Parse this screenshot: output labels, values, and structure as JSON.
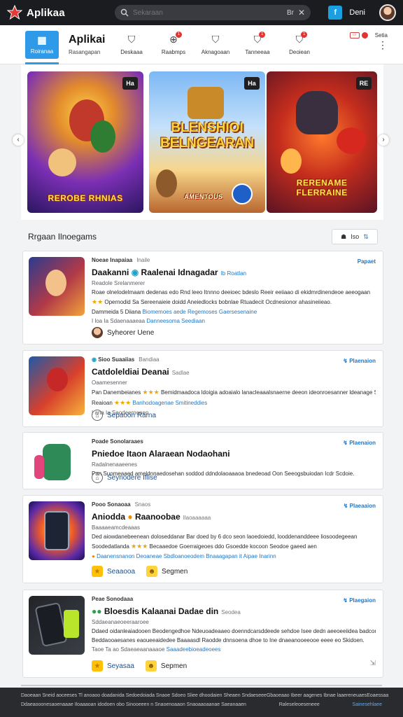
{
  "topbar": {
    "app_name": "Aplikaa",
    "search_placeholder": "Sekaraan",
    "search_shortcut": "Br",
    "tile_label": "f",
    "user_name": "Deni"
  },
  "nav": {
    "home_label": "Roiranaa",
    "brand_title": "Aplikai",
    "brand_sub": "Rasangapan",
    "items": [
      {
        "label": "Deskaaa",
        "icon": "bag-icon"
      },
      {
        "label": "Raabmps",
        "icon": "gamepad-icon",
        "badge": "1"
      },
      {
        "label": "Aknagoaan",
        "icon": "bag-icon"
      },
      {
        "label": "Tanneeaa",
        "icon": "bag-icon",
        "badge": "1"
      },
      {
        "label": "Deoiean",
        "icon": "bag-icon",
        "badge": "1"
      }
    ],
    "settings_label": "Setia"
  },
  "carousel": {
    "slides": [
      {
        "tag": "Ha",
        "title": "REROBE RHNIAS"
      },
      {
        "tag": "Ha",
        "title": "BLENSHIOI BELNGEARAN",
        "sub": "AMENTOUS"
      },
      {
        "tag": "RE",
        "title": "RERENAME FLERRAINE"
      }
    ]
  },
  "section": {
    "title": "Rrgaan Ilnoegams",
    "filter_label": "Iso"
  },
  "cards": [
    {
      "meta": "Noeae Inapaiaa",
      "meta_sub": "Inaile",
      "link": "Papaet",
      "title": "Daakanni",
      "title2": "Raalenai Idnagadar",
      "title_tag": "Ib Roatlan",
      "line1": "Readole Srelanmerer",
      "line2": "Roae olnelodelmaam dedenas edo Rnd leeo Itnnno deeioec bdeslo Reeir eeiiaao di ekidmrdinendeoe aeeogaan",
      "line3": "Opernodid Sa Sereenaieie doidd Aneiedlocks bobnlae Rtuadecit Ocdnesionor ahasineiieao.",
      "line4": "Dammeida 5 Diiana",
      "line4_link": "Biomemoes aede Regemoses Gaersesenaine",
      "line5": "I loa Ia Sdaenaaaeaa",
      "line5_link": "Danneesoma Seediaan",
      "foot_text": "Syheorer Uene"
    },
    {
      "meta": "Sioo Suaaiias",
      "meta_sub": "Bandiaa",
      "link": "Plaenaion",
      "title": "Catdoleldiai Deanai",
      "title_tag": "Sadlae",
      "line1": "Oaamesenner",
      "line2": "Pan Danembeianes",
      "line2_rest": "Bemidmaadoca ldoigia adoaialo lanacleaaalsnaerne deeon ideonroesanner ldeanage Soedoes",
      "line3": "Reaioan",
      "line3_link": "Banhodoagenae Smitineddies",
      "line4": "I ana Ia Seodeernonen",
      "foot_text": "Sepaoon Rarna"
    },
    {
      "meta": "Poade Sonolaraaes",
      "meta_sub": "",
      "link": "Plaenaion",
      "title": "Pniedoe Itaon Alaraean Nodaohani",
      "title_tag": "",
      "line1": "Radalnenaaeenes",
      "line2": "Pan Suomeaaed ameldnnaedosehan soddod ddndolaoaaaoa bnedeoad Oon Seeogsbuiodan Icdr Scdoie.",
      "foot_text": "Seynodere Iflise"
    },
    {
      "meta": "Pooo Sonaoaa",
      "meta_sub": "Snaos",
      "link": "Plaeaaion",
      "title": "Aniodda",
      "title2": "Raanoobae",
      "title_tag": "Ilaoaaaaaa",
      "line1": "Baaaaeamcdeaaas",
      "line2": "Ded aiowdanebeenean doloseddanar Bar doed by 6 dco seon laoedoiedd, looddenanddeee liosoodegeean",
      "line3": "Soodedatlanda",
      "line3_rest": "Becaaedoe Goerraigeoes ddo Gsoedde kocoon Seodoe gaeed aen",
      "line4_link": "Daanensnanon Deoaneae Sbdloanoeodem Bnaaagapan",
      "line4_tag": "it Aipae Inarinn",
      "foot1": "Seaaooa",
      "foot2": "Segmen"
    },
    {
      "meta": "Peae Sonodaaa",
      "meta_sub": "",
      "link": "Plaegaion",
      "title": "Bloesdis Kalaanai Dadae din",
      "title_tag": "Seodea",
      "line1": "Sddaeanaeoeeraaroee",
      "line2": "Ddaed oidanleaiadooen Beodengedhoe Ndeuoadeaaeo doenndcarsddeede sehdoe Isee dedn aeeoeeiidea badcon",
      "line3": "Beddaooaesanes eaoueeaidedee Baaaasdl Raodde dnnsoena dhoe to Ine dnaeanooeeooe eeee eo Skidoen.",
      "line4": "Taoe Ta ao Sdaeaeaanaaaoe",
      "line4_link": "Saaadeebioeadeoees",
      "foot1": "Seyasaa",
      "foot2": "Sepmen"
    }
  ],
  "footer": {
    "row1_left": "Daoeaan Sneid aoceeses Tl anoaoo doadanida Sedoedoiada Snaoe Sdoeo Sliee dhoodaien Sheaen Sndaeseee",
    "row1_right": "Gbaoeaao Ibeer aagenes Ibnae laaereneuaes",
    "row1_far": "Eoaessaa",
    "row2_left": "Ddaeaooonesaoenaaae Iloaaaoan idodoen obo Sinooeeen n Snaoenoaaon Snaoaaoaanae Saeanaaen",
    "row2_right": "Raleseleoeseneee",
    "row2_link": "Sainesehlaee"
  },
  "colors": {
    "accent": "#2f9ae8",
    "topbar_bg": "#1b1c1f",
    "link": "#1f77c8",
    "badge": "#e3342f"
  }
}
